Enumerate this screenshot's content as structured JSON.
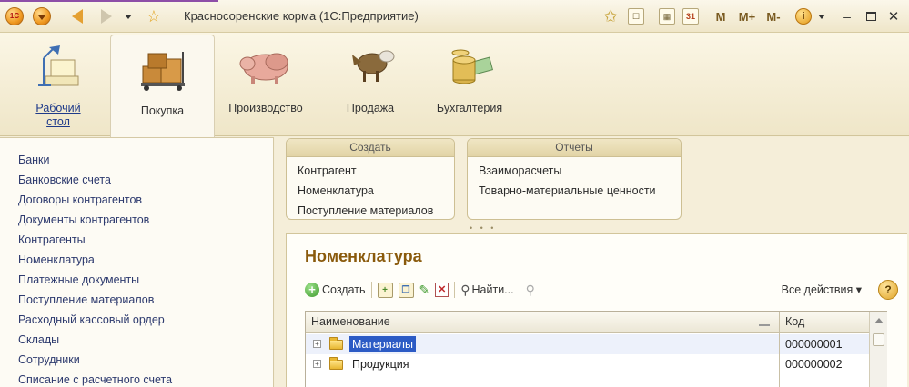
{
  "window": {
    "title": "Красносоренские корма  (1С:Предприятие)",
    "icons": [
      "1c-logo-icon",
      "main-menu-icon",
      "back-arrow-icon",
      "forward-arrow-icon",
      "history-dropdown-icon",
      "favorites-star-icon"
    ]
  },
  "titlebar_tools": {
    "m": "M",
    "m_plus": "M+",
    "m_minus": "M-",
    "info": "i",
    "minimize": "–"
  },
  "sections": [
    {
      "label": "Рабочий\nстол",
      "icon": "desktop-lamp-icon"
    },
    {
      "label": "Покупка",
      "icon": "purchase-boxes-icon"
    },
    {
      "label": "Производство",
      "icon": "production-pig-icon"
    },
    {
      "label": "Продажа",
      "icon": "sales-goat-icon"
    },
    {
      "label": "Бухгалтерия",
      "icon": "accounting-coins-icon"
    }
  ],
  "nav": {
    "items": [
      "Банки",
      "Банковские счета",
      "Договоры контрагентов",
      "Документы контрагентов",
      "Контрагенты",
      "Номенклатура",
      "Платежные документы",
      "Поступление материалов",
      "Расходный кассовый ордер",
      "Склады",
      "Сотрудники",
      "Списание с расчетного счета"
    ]
  },
  "groups": {
    "create": {
      "title": "Создать",
      "items": [
        "Контрагент",
        "Номенклатура",
        "Поступление материалов"
      ]
    },
    "reports": {
      "title": "Отчеты",
      "items": [
        "Взаиморасчеты",
        "Товарно-материальные ценности"
      ]
    },
    "grip": "• • •"
  },
  "form": {
    "title": "Номенклатура",
    "toolbar": {
      "create_label": "Создать",
      "find_label": "Найти...",
      "all_actions_label": "Все действия ▾",
      "help": "?"
    },
    "table": {
      "columns": [
        "Наименование",
        "Код"
      ],
      "rows": [
        {
          "name": "Материалы",
          "code": "000000001",
          "selected": true
        },
        {
          "name": "Продукция",
          "code": "000000002",
          "selected": false
        }
      ]
    }
  }
}
